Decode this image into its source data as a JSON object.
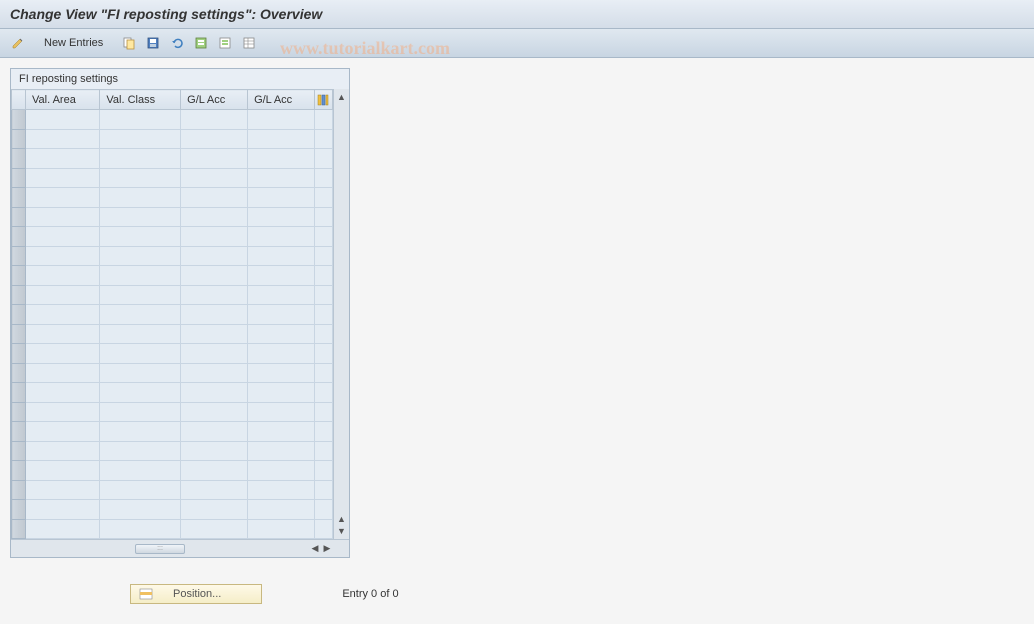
{
  "header": {
    "title": "Change View \"FI reposting settings\": Overview"
  },
  "toolbar": {
    "new_entries_label": "New Entries",
    "icons": {
      "pencil": "pencil-icon",
      "copy": "copy-icon",
      "save": "save-icon",
      "undo": "undo-icon",
      "select_all": "select-all-icon",
      "deselect": "deselect-icon",
      "table_settings": "table-settings-icon"
    }
  },
  "panel": {
    "title": "FI reposting settings",
    "columns": [
      {
        "label": "Val. Area"
      },
      {
        "label": "Val. Class"
      },
      {
        "label": "G/L Acc"
      },
      {
        "label": "G/L Acc"
      }
    ],
    "row_count": 22
  },
  "footer": {
    "position_label": "Position...",
    "entry_text": "Entry 0 of 0"
  },
  "watermark": "www.tutorialkart.com"
}
